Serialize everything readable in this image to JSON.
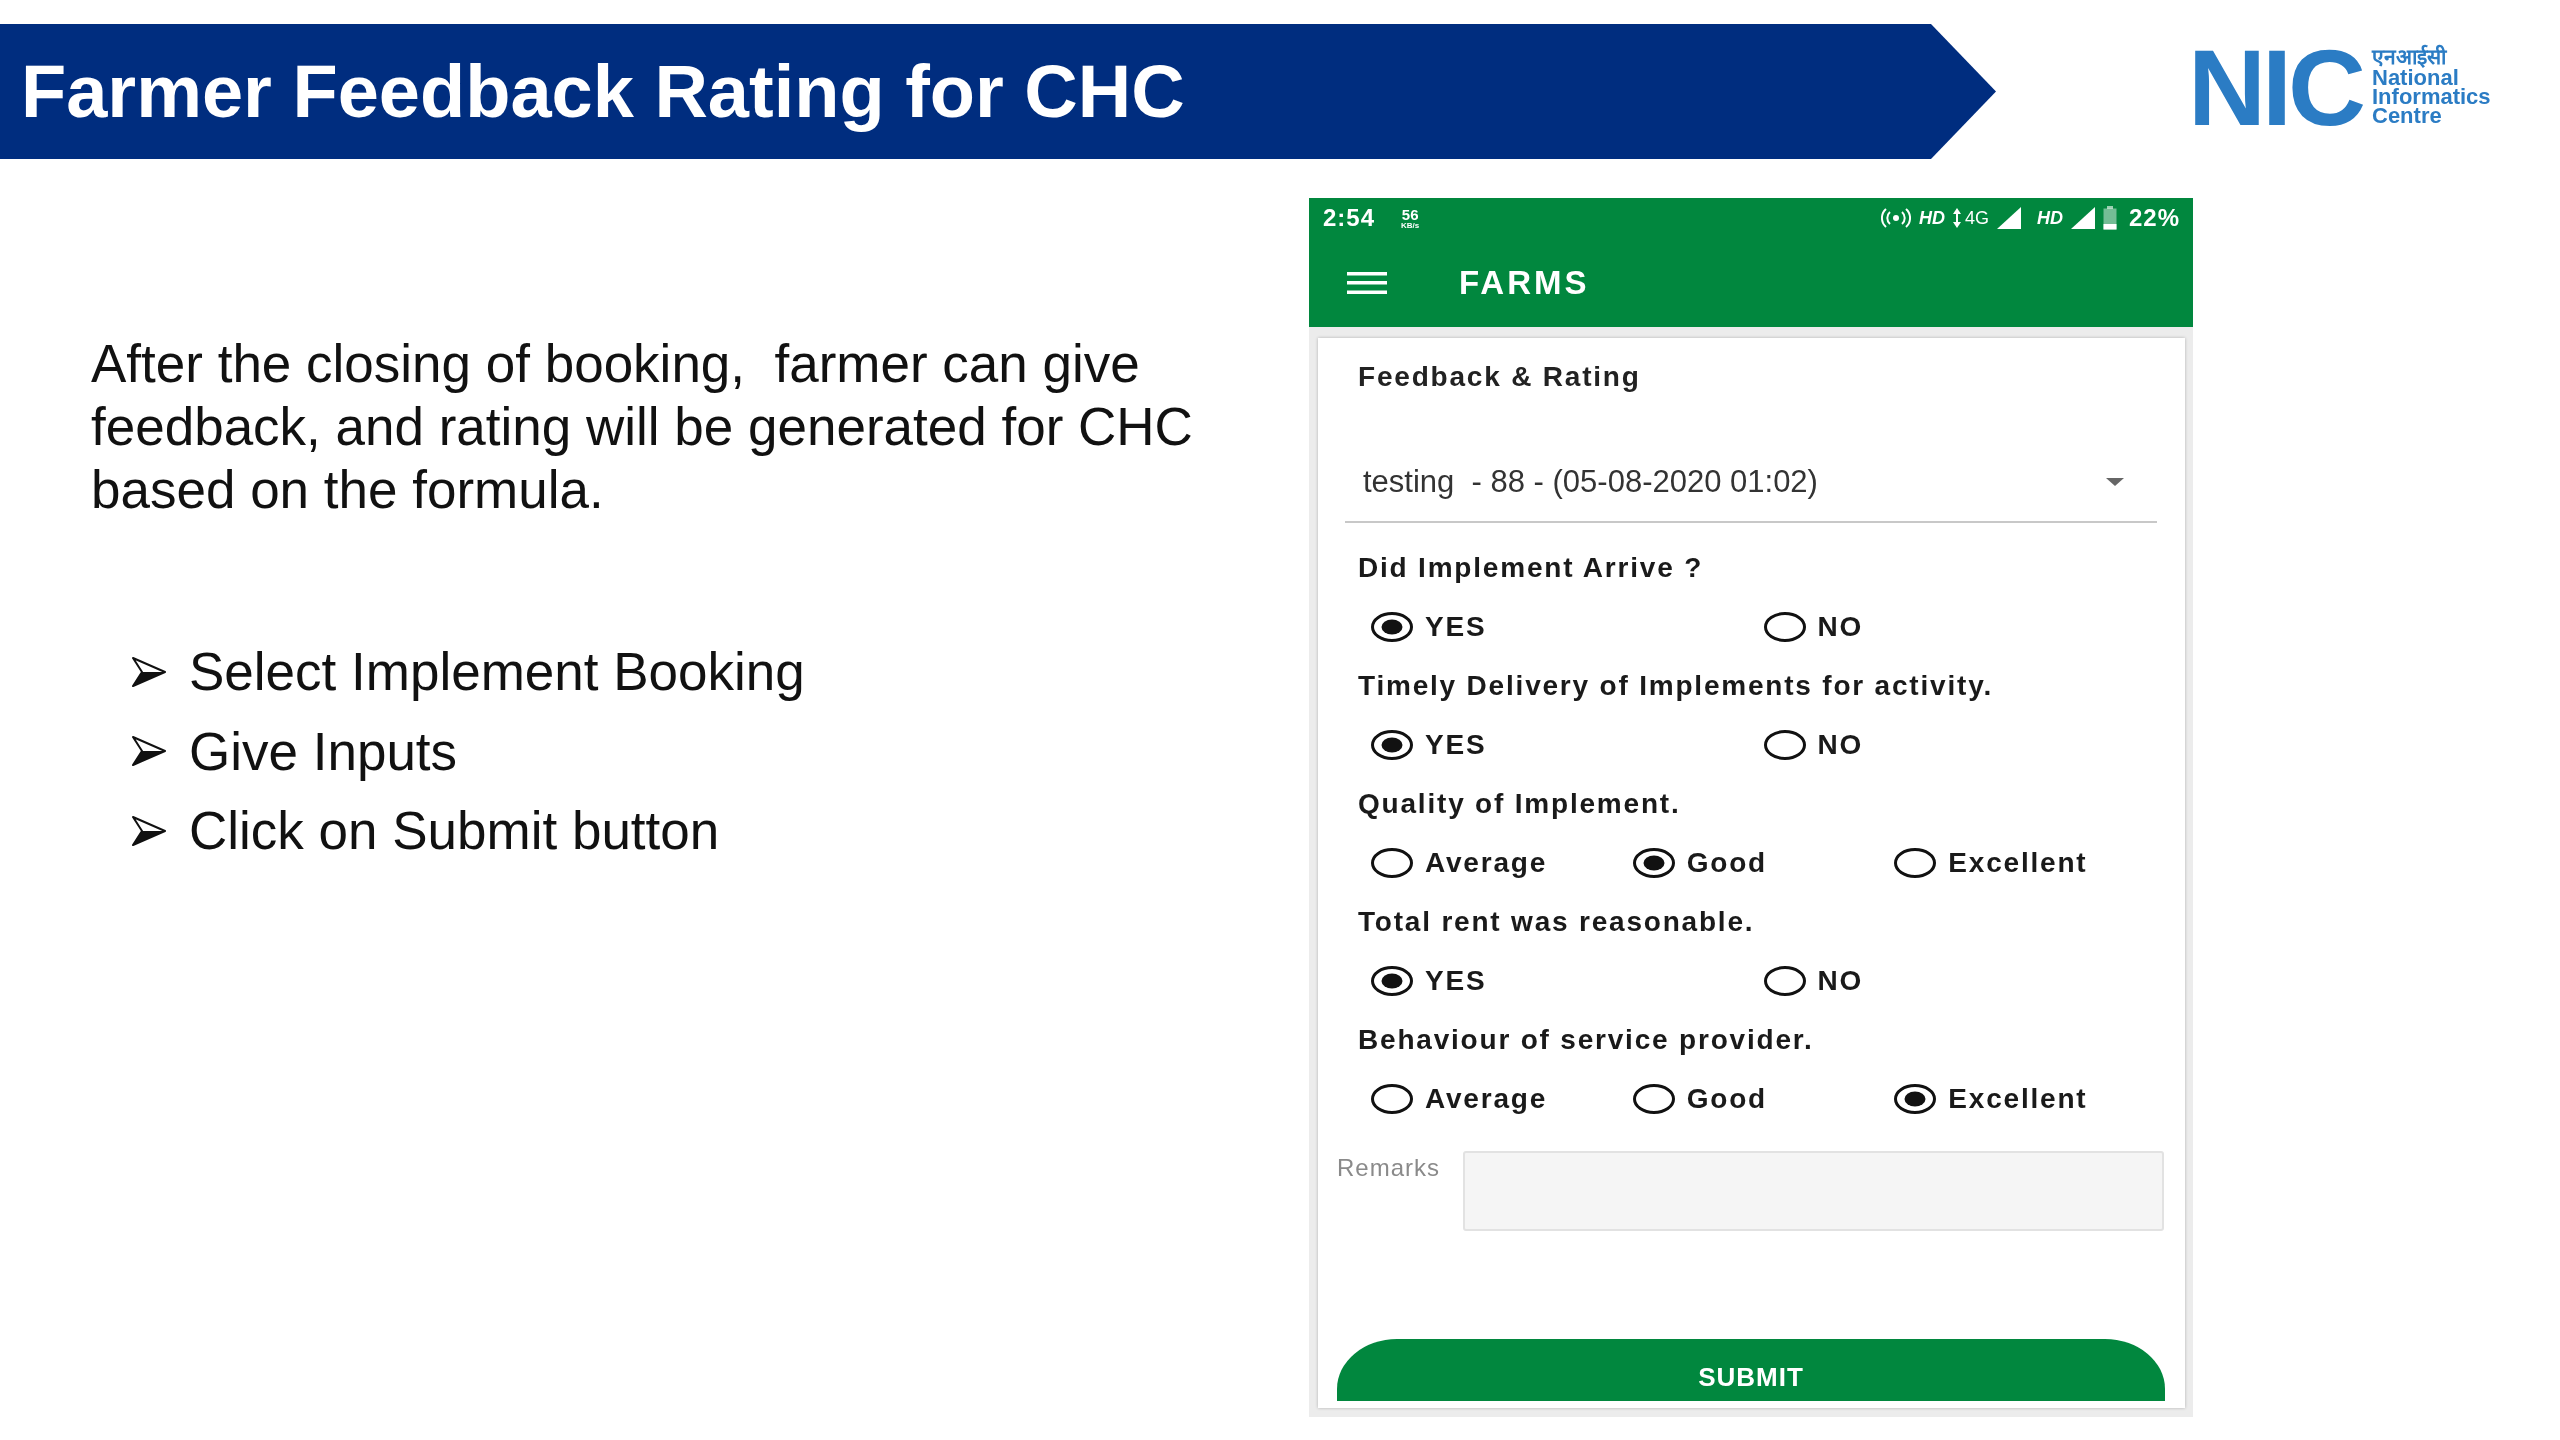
{
  "slide": {
    "title": "Farmer Feedback Rating for CHC",
    "logo": {
      "mark": "NIC",
      "hindi_name": "एनआईसी",
      "name_lines": [
        "National",
        "Informatics",
        "Centre"
      ]
    },
    "description": "After the closing of booking,  farmer can give feedback, and rating will be generated for CHC based on the formula.",
    "steps": [
      "Select Implement Booking",
      "Give Inputs",
      "Click on Submit button"
    ]
  },
  "phone": {
    "status_bar": {
      "time": "2:54",
      "speed": "56",
      "speed_unit": "KB/s",
      "sim1_label": "HD",
      "network_type": "4G",
      "sim2_label": "HD",
      "battery": "22%"
    },
    "app_bar": {
      "title": "FARMS"
    },
    "form": {
      "heading": "Feedback & Rating",
      "booking_select": {
        "value": "testing  - 88 - (05-08-2020 01:02)"
      },
      "questions": [
        {
          "label": "Did Implement Arrive ?",
          "options": [
            {
              "label": "YES",
              "selected": true
            },
            {
              "label": "NO",
              "selected": false
            }
          ]
        },
        {
          "label": "Timely Delivery of Implements for activity.",
          "options": [
            {
              "label": "YES",
              "selected": true
            },
            {
              "label": "NO",
              "selected": false
            }
          ]
        },
        {
          "label": "Quality of Implement.",
          "options": [
            {
              "label": "Average",
              "selected": false
            },
            {
              "label": "Good",
              "selected": true
            },
            {
              "label": "Excellent",
              "selected": false
            }
          ]
        },
        {
          "label": "Total rent was reasonable.",
          "options": [
            {
              "label": "YES",
              "selected": true
            },
            {
              "label": "NO",
              "selected": false
            }
          ]
        },
        {
          "label": "Behaviour of service provider.",
          "options": [
            {
              "label": "Average",
              "selected": false
            },
            {
              "label": "Good",
              "selected": false
            },
            {
              "label": "Excellent",
              "selected": true
            }
          ]
        }
      ],
      "remarks": {
        "label": "Remarks"
      },
      "submit_button": "SUBMIT"
    }
  }
}
